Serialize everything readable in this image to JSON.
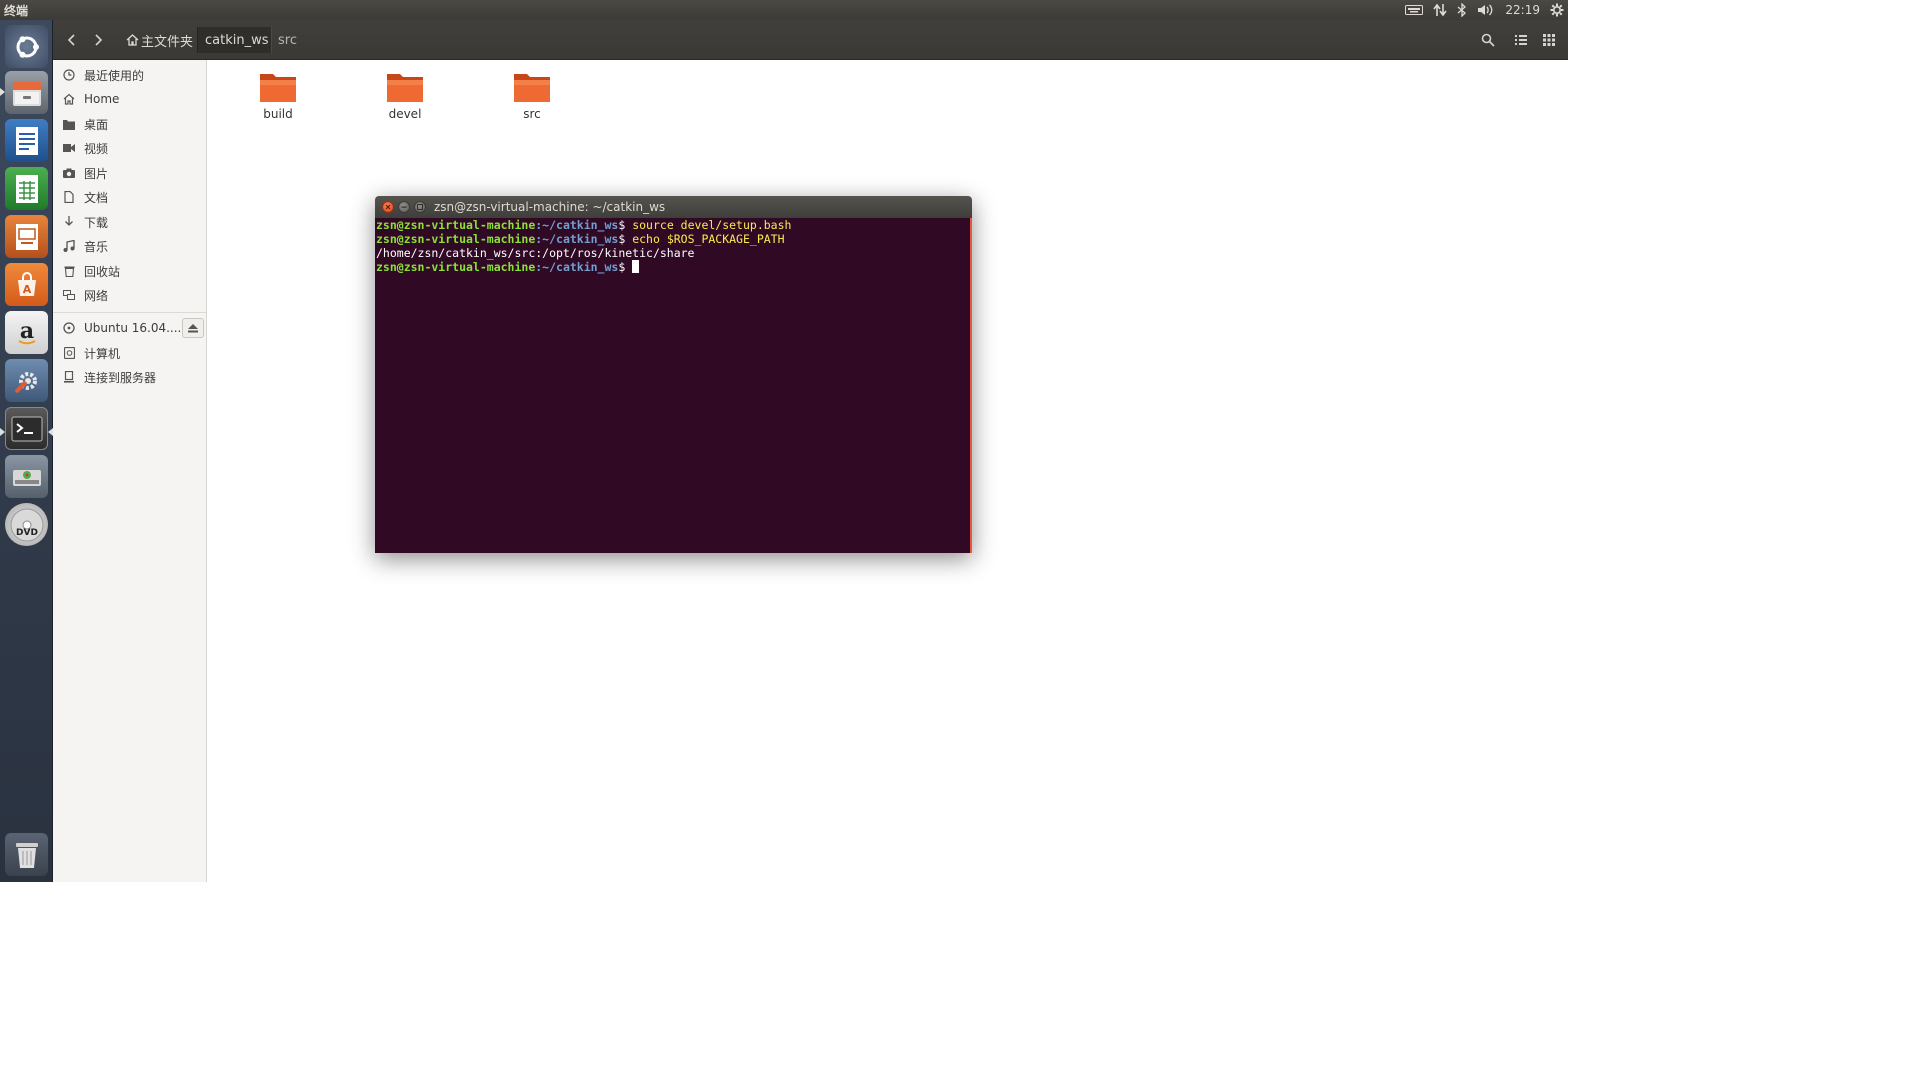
{
  "top_panel": {
    "app_title": "终端",
    "clock": "22:19",
    "icons": [
      "keyboard-icon",
      "network-icon",
      "bluetooth-icon",
      "volume-icon",
      "settings-gear-icon"
    ]
  },
  "launcher": {
    "items": [
      {
        "name": "ubuntu-dash-icon"
      },
      {
        "name": "files-icon"
      },
      {
        "name": "libreoffice-writer-icon"
      },
      {
        "name": "libreoffice-calc-icon"
      },
      {
        "name": "libreoffice-impress-icon"
      },
      {
        "name": "software-center-icon"
      },
      {
        "name": "amazon-icon"
      },
      {
        "name": "system-settings-icon"
      },
      {
        "name": "terminal-icon"
      },
      {
        "name": "disk-icon"
      },
      {
        "name": "dvd-icon"
      },
      {
        "name": "trash-icon"
      }
    ]
  },
  "toolbar": {
    "breadcrumbs": [
      {
        "label": "主文件夹",
        "icon": "home-icon"
      },
      {
        "label": "catkin_ws"
      },
      {
        "label": "src"
      }
    ]
  },
  "sidebar": {
    "items": [
      {
        "label": "最近使用的",
        "icon": "recent-icon"
      },
      {
        "label": "Home",
        "icon": "home-icon"
      },
      {
        "label": "桌面",
        "icon": "desktop-folder-icon"
      },
      {
        "label": "视频",
        "icon": "video-icon"
      },
      {
        "label": "图片",
        "icon": "camera-icon"
      },
      {
        "label": "文档",
        "icon": "document-icon"
      },
      {
        "label": "下载",
        "icon": "download-icon"
      },
      {
        "label": "音乐",
        "icon": "music-icon"
      },
      {
        "label": "回收站",
        "icon": "trash-icon"
      },
      {
        "label": "网络",
        "icon": "network-icon"
      }
    ],
    "devices": [
      {
        "label": "Ubuntu 16.04....",
        "icon": "disc-icon"
      },
      {
        "label": "计算机",
        "icon": "computer-icon"
      },
      {
        "label": "连接到服务器",
        "icon": "server-icon"
      }
    ]
  },
  "content": {
    "folders": [
      {
        "label": "build"
      },
      {
        "label": "devel"
      },
      {
        "label": "src"
      }
    ]
  },
  "terminal": {
    "title": "zsn@zsn-virtual-machine: ~/catkin_ws",
    "prompt_user": "zsn@zsn-virtual-machine",
    "prompt_path": ":~/catkin_ws",
    "prompt_symbol": "$ ",
    "lines": [
      {
        "type": "cmd",
        "command": "source devel/setup.bash"
      },
      {
        "type": "cmd",
        "command": "echo $ROS_PACKAGE_PATH"
      },
      {
        "type": "out",
        "text": "/home/zsn/catkin_ws/src:/opt/ros/kinetic/share"
      },
      {
        "type": "cmd",
        "command": ""
      }
    ]
  },
  "colors": {
    "terminal_bg": "#300a24",
    "prompt_user": "#8ae234",
    "prompt_path": "#729fcf",
    "command": "#fce94f",
    "folder": "#e95f2c",
    "close_button": "#e95420"
  }
}
